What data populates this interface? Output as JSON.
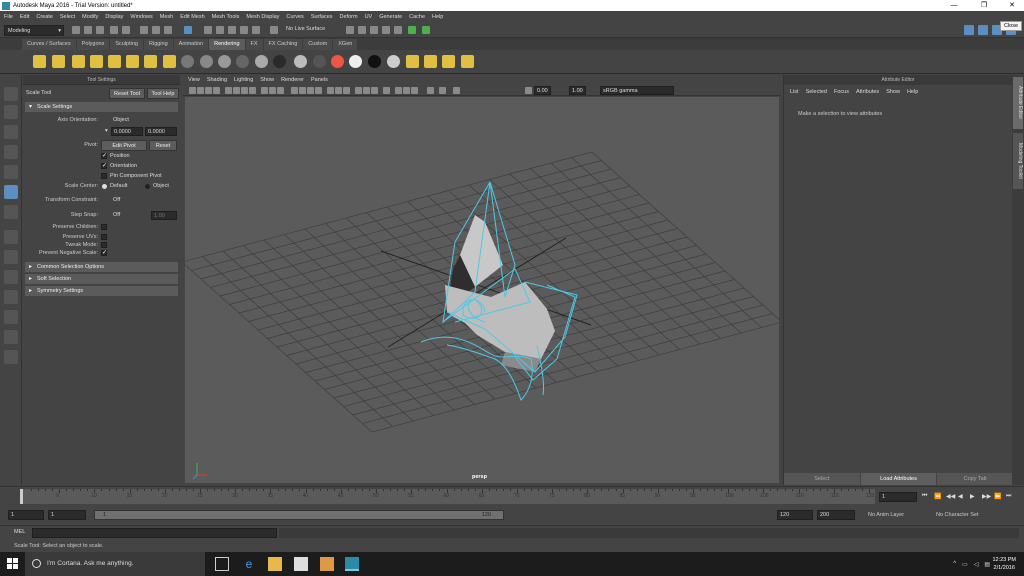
{
  "window": {
    "title": "Autodesk Maya 2016 - Trial Version: untitled*",
    "close_tooltip": "Close"
  },
  "menubar": [
    "File",
    "Edit",
    "Create",
    "Select",
    "Modify",
    "Display",
    "Windows",
    "Mesh",
    "Edit Mesh",
    "Mesh Tools",
    "Mesh Display",
    "Curves",
    "Surfaces",
    "Deform",
    "UV",
    "Generate",
    "Cache",
    "Help"
  ],
  "statusline": {
    "mode": "Modeling",
    "live_surface": "No Live Surface"
  },
  "shelf_tabs": [
    "Curves / Surfaces",
    "Polygons",
    "Sculpting",
    "Rigging",
    "Animation",
    "Rendering",
    "FX",
    "FX Caching",
    "Custom",
    "XGen"
  ],
  "active_shelf": "Rendering",
  "tool_settings": {
    "panel_title": "Tool Settings",
    "tool_name": "Scale Tool",
    "reset_tool": "Reset Tool",
    "tool_help": "Tool Help",
    "scale_settings": {
      "title": "Scale Settings",
      "axis_orientation_label": "Axis Orientation:",
      "axis_orientation_value": "Object",
      "field1": "0.0000",
      "field2": "0.0000",
      "pivot_label": "Pivot:",
      "edit_pivot": "Edit Pivot",
      "reset": "Reset",
      "position": "Position",
      "orientation": "Orientation",
      "pin_component_pivot": "Pin Component Pivot",
      "scale_center_label": "Scale Center:",
      "default": "Default",
      "object": "Object",
      "transform_constraint_label": "Transform Constraint:",
      "transform_constraint_value": "Off",
      "step_snap_label": "Step Snap:",
      "step_snap_value": "Off",
      "step_snap_amount": "1.00",
      "preserve_children": "Preserve Children:",
      "preserve_uvs": "Preserve UVs:",
      "tweak_mode": "Tweak Mode:",
      "prevent_negative_scale": "Prevent Negative Scale:"
    },
    "sections": [
      "Common Selection Options",
      "Soft Selection",
      "Symmetry Settings"
    ]
  },
  "viewport": {
    "menu": [
      "View",
      "Shading",
      "Lighting",
      "Show",
      "Renderer",
      "Panels"
    ],
    "exposure": "0.00",
    "gamma": "1.00",
    "color_space": "sRGB gamma",
    "camera": "persp"
  },
  "attribute_editor": {
    "title": "Attribute Editor",
    "menu": [
      "List",
      "Selected",
      "Focus",
      "Attributes",
      "Show",
      "Help"
    ],
    "message": "Make a selection to view attributes",
    "buttons": [
      "Select",
      "Load Attributes",
      "Copy Tab"
    ]
  },
  "side_tabs": [
    "Attribute Editor",
    "Modeling Toolkit"
  ],
  "time_slider": {
    "ticks": [
      5,
      10,
      15,
      20,
      25,
      30,
      35,
      40,
      45,
      50,
      55,
      60,
      65,
      70,
      75,
      80,
      85,
      90,
      95,
      100,
      105,
      110,
      115,
      120
    ],
    "current_frame": "1",
    "playback_buttons": [
      "⏮",
      "⏪",
      "◀◀",
      "◀",
      "▶",
      "▶▶",
      "⏩",
      "⏭"
    ]
  },
  "range_slider": {
    "start_outer": "1",
    "start_inner": "1",
    "bar_start": "1",
    "bar_end": "120",
    "end_inner": "120",
    "end_outer": "200",
    "anim_layer": "No Anim Layer",
    "character_set": "No Character Set"
  },
  "command_line": {
    "label": "MEL",
    "help_text": "Scale Tool: Select an object to scale."
  },
  "taskbar": {
    "cortana": "I'm Cortana. Ask me anything.",
    "time": "12:23 PM",
    "date": "2/1/2016"
  }
}
